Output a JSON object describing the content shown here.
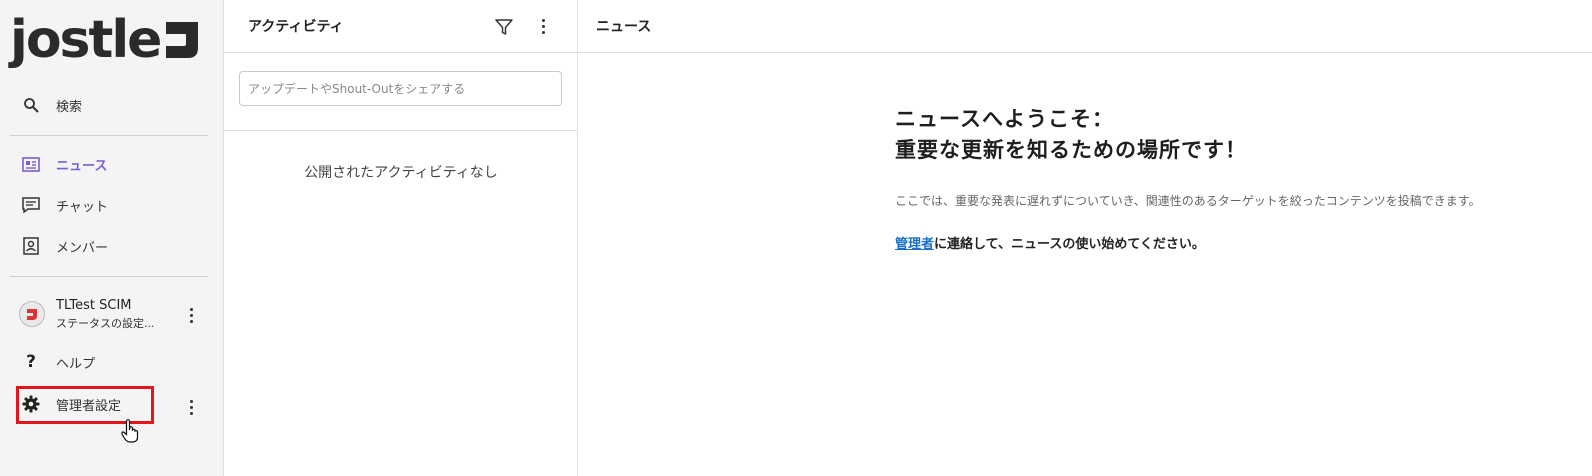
{
  "sidebar": {
    "logo": "jostle",
    "search_label": "検索",
    "items": [
      {
        "label": "ニュース"
      },
      {
        "label": "チャット"
      },
      {
        "label": "メンバー"
      }
    ],
    "profile": {
      "name": "TLTest SCIM",
      "status": "ステータスの設定..."
    },
    "help_label": "ヘルプ",
    "admin_label": "管理者設定"
  },
  "activity": {
    "title": "アクティビティ",
    "share_placeholder": "アップデートやShout-Outをシェアする",
    "empty_text": "公開されたアクティビティなし"
  },
  "news": {
    "title": "ニュース",
    "welcome_line1": "ニュースへようこそ：",
    "welcome_line2": "重要な更新を知るための場所です！",
    "description": "ここでは、重要な発表に遅れずについていき、関連性のあるターゲットを絞ったコンテンツを投稿できます。",
    "contact_link": "管理者",
    "contact_rest": "に連絡して、ニュースの使い始めてください。"
  },
  "colors": {
    "accent": "#7b5cd6",
    "link": "#1a6fc9",
    "highlight_box": "#e3141b"
  },
  "icons": {
    "search": "search-icon",
    "news": "news-icon",
    "chat": "chat-icon",
    "members": "members-icon",
    "help": "help-icon",
    "admin": "gear-icon",
    "filter": "filter-icon",
    "more": "more-vertical-icon"
  }
}
